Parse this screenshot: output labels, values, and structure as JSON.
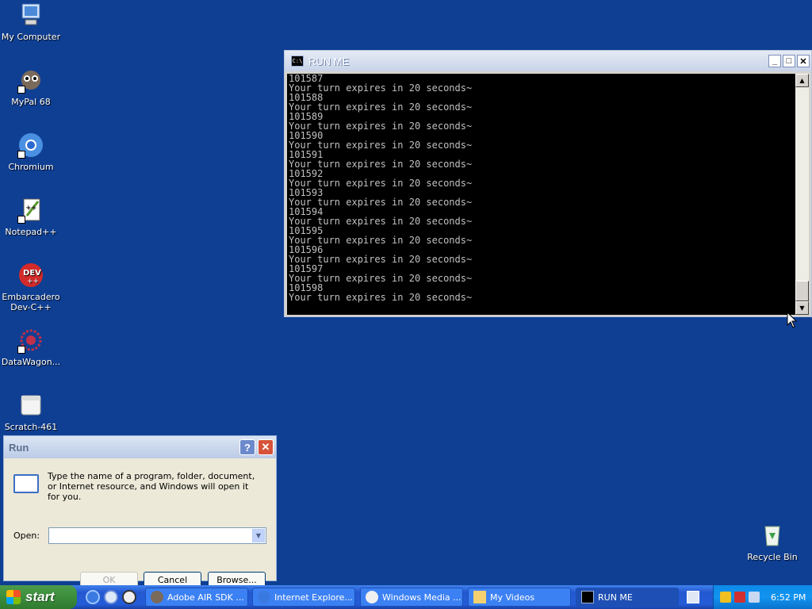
{
  "desktop": {
    "icons": [
      {
        "label": "My Computer",
        "color": "#6a9ad8"
      },
      {
        "label": "MyPal 68",
        "color": "#5a4a3a"
      },
      {
        "label": "Chromium",
        "color": "#4a90e2"
      },
      {
        "label": "Notepad++",
        "color": "#9acb5a"
      },
      {
        "label": "Embarcadero Dev-C++",
        "color": "#d32a2a"
      },
      {
        "label": "DataWagon...",
        "color": "#c0304a"
      },
      {
        "label": "Scratch-461",
        "color": "#f0f0f0"
      },
      {
        "label": "Recycle Bin",
        "color": "#e8f0e8"
      }
    ]
  },
  "console": {
    "title": "RUN ME",
    "icon_text": "C:\\",
    "lines": [
      "101587",
      "Your turn expires in 20 seconds~",
      "101588",
      "Your turn expires in 20 seconds~",
      "101589",
      "Your turn expires in 20 seconds~",
      "101590",
      "Your turn expires in 20 seconds~",
      "101591",
      "Your turn expires in 20 seconds~",
      "101592",
      "Your turn expires in 20 seconds~",
      "101593",
      "Your turn expires in 20 seconds~",
      "101594",
      "Your turn expires in 20 seconds~",
      "101595",
      "Your turn expires in 20 seconds~",
      "101596",
      "Your turn expires in 20 seconds~",
      "101597",
      "Your turn expires in 20 seconds~",
      "101598",
      "Your turn expires in 20 seconds~"
    ]
  },
  "run_dialog": {
    "title": "Run",
    "description": "Type the name of a program, folder, document, or Internet resource, and Windows will open it for you.",
    "open_label": "Open:",
    "open_value": "",
    "ok_label": "OK",
    "cancel_label": "Cancel",
    "browse_label": "Browse..."
  },
  "taskbar": {
    "start_label": "start",
    "tasks": [
      {
        "label": "Adobe AIR SDK ..."
      },
      {
        "label": "Internet Explore..."
      },
      {
        "label": "Windows Media ..."
      },
      {
        "label": "My Videos"
      },
      {
        "label": "RUN ME"
      }
    ],
    "clock": "6:52 PM"
  }
}
